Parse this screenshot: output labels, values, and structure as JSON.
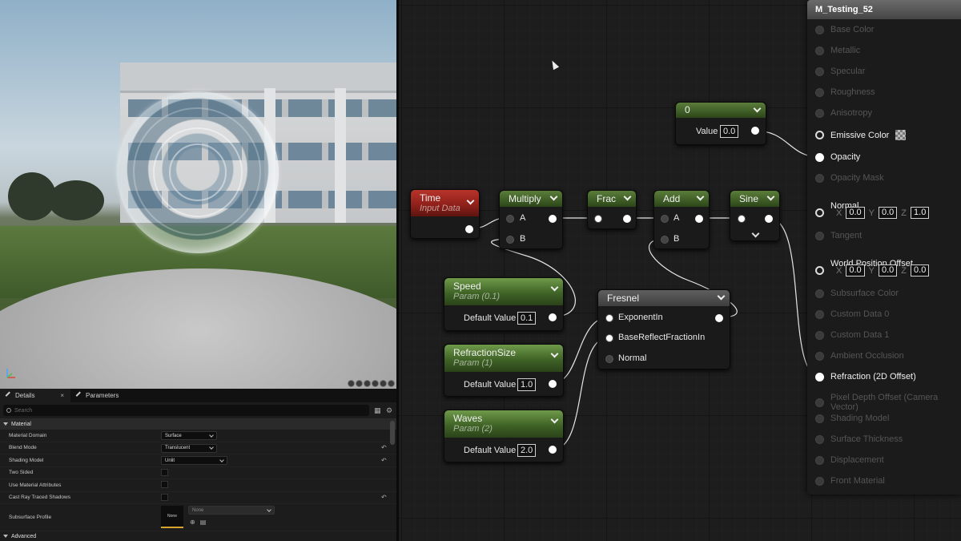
{
  "viewport": {
    "icons": [
      "lighting-icon",
      "material-sphere-icon",
      "plane-icon",
      "cube-icon",
      "cylinder-icon",
      "settings-icon"
    ]
  },
  "details_panel": {
    "tabs": [
      {
        "label": "Details",
        "icon": "pencil-icon",
        "active": true
      },
      {
        "label": "Parameters",
        "icon": "pencil-icon",
        "active": false
      }
    ],
    "search_placeholder": "Search",
    "category": "Material",
    "properties": [
      {
        "label": "Material Domain",
        "type": "dropdown",
        "value": "Surface"
      },
      {
        "label": "Blend Mode",
        "type": "dropdown",
        "value": "Translucent"
      },
      {
        "label": "Shading Model",
        "type": "dropdown",
        "value": "Unlit"
      },
      {
        "label": "Two Sided",
        "type": "checkbox",
        "checked": false
      },
      {
        "label": "Use Material Attributes",
        "type": "checkbox",
        "checked": false
      },
      {
        "label": "Cast Ray Traced Shadows",
        "type": "checkbox",
        "checked": false
      }
    ],
    "subsurface": {
      "label": "Subsurface Profile",
      "thumb": "None",
      "dropdown": "None"
    },
    "advanced_label": "Advanced"
  },
  "graph": {
    "nodes": {
      "constant": {
        "title": "0",
        "value_label": "Value",
        "value": "0.0"
      },
      "time": {
        "title": "Time",
        "subtitle": "Input Data"
      },
      "multiply": {
        "title": "Multiply",
        "in_a": "A",
        "in_b": "B"
      },
      "frac": {
        "title": "Frac"
      },
      "add": {
        "title": "Add",
        "in_a": "A",
        "in_b": "B"
      },
      "sine": {
        "title": "Sine"
      },
      "speed": {
        "title": "Speed",
        "subtitle": "Param (0.1)",
        "default_label": "Default Value",
        "default_value": "0.1"
      },
      "refraction_size": {
        "title": "RefractionSize",
        "subtitle": "Param (1)",
        "default_label": "Default Value",
        "default_value": "1.0"
      },
      "waves": {
        "title": "Waves",
        "subtitle": "Param (2)",
        "default_label": "Default Value",
        "default_value": "2.0"
      },
      "fresnel": {
        "title": "Fresnel",
        "inputs": [
          "ExponentIn",
          "BaseReflectFractionIn",
          "Normal"
        ]
      }
    },
    "result": {
      "title": "M_Testing_52",
      "pins": [
        {
          "name": "Base Color",
          "active": false
        },
        {
          "name": "Metallic",
          "active": false
        },
        {
          "name": "Specular",
          "active": false
        },
        {
          "name": "Roughness",
          "active": false
        },
        {
          "name": "Anisotropy",
          "active": false
        },
        {
          "name": "Emissive Color",
          "active": true
        },
        {
          "name": "Opacity",
          "active": true
        },
        {
          "name": "Opacity Mask",
          "active": false
        },
        {
          "name": "Normal",
          "active": true
        },
        {
          "name": "Tangent",
          "active": false
        },
        {
          "name": "World Position Offset",
          "active": true
        },
        {
          "name": "Subsurface Color",
          "active": false
        },
        {
          "name": "Custom Data 0",
          "active": false
        },
        {
          "name": "Custom Data 1",
          "active": false
        },
        {
          "name": "Ambient Occlusion",
          "active": false
        },
        {
          "name": "Refraction (2D Offset)",
          "active": true
        },
        {
          "name": "Pixel Depth Offset (Camera Vector)",
          "active": false
        },
        {
          "name": "Shading Model",
          "active": false
        },
        {
          "name": "Surface Thickness",
          "active": false
        },
        {
          "name": "Displacement",
          "active": false
        },
        {
          "name": "Front Material",
          "active": false
        }
      ],
      "normal_vec": {
        "x_label": "X",
        "x": "0.0",
        "y_label": "Y",
        "y": "0.0",
        "z_label": "Z",
        "z": "1.0"
      },
      "wpo_vec": {
        "x_label": "X",
        "x": "0.0",
        "y_label": "Y",
        "y": "0.0",
        "z_label": "Z",
        "z": "0.0"
      }
    }
  },
  "colors": {
    "param_header": "#3f6326",
    "time_header": "#8c1f19",
    "math_header": "#3a5723",
    "graph_bg": "#1d1d1d"
  }
}
